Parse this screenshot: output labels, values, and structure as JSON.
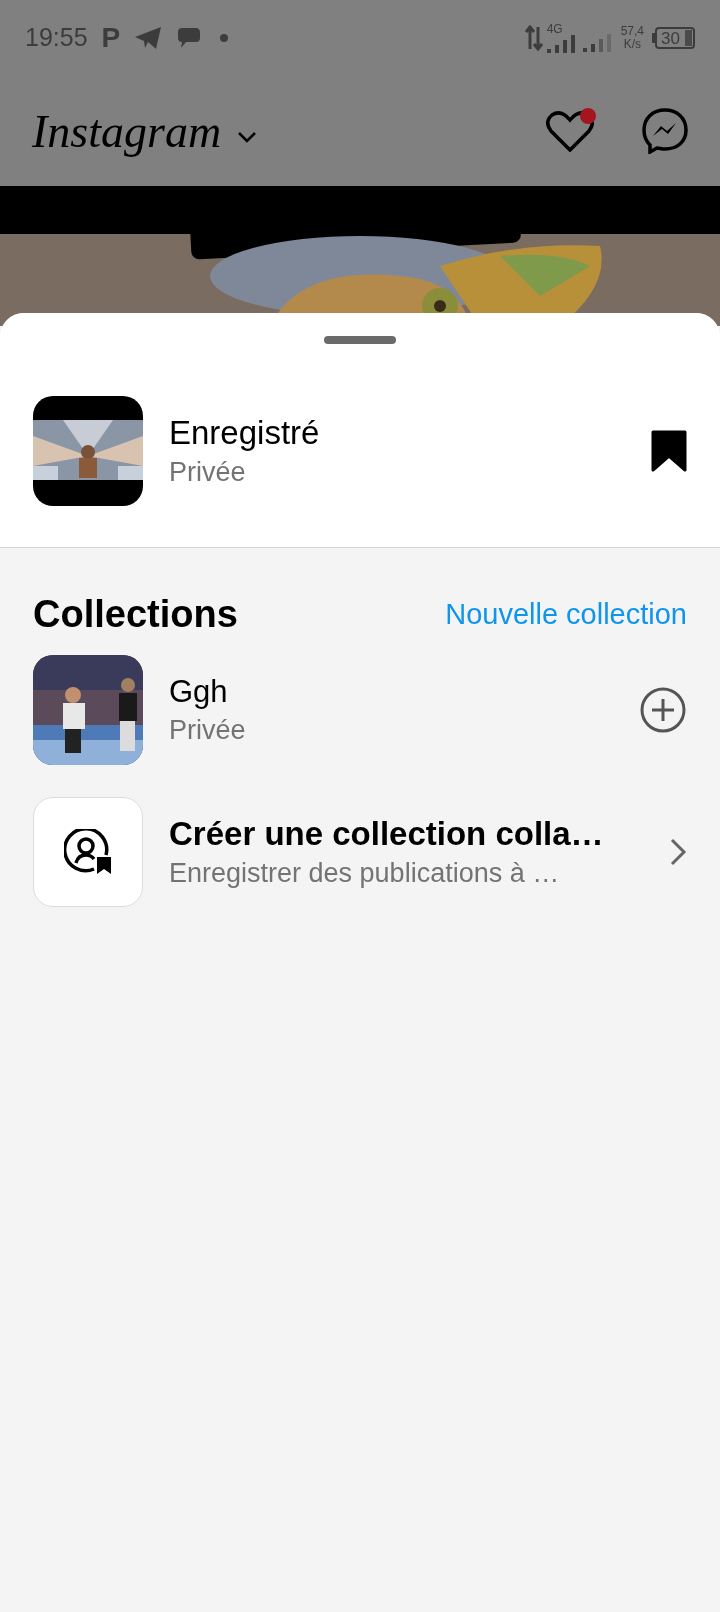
{
  "status_bar": {
    "time": "19:55",
    "app_letter": "P",
    "network": "4G",
    "speed": "57,4",
    "speed_unit": "K/s",
    "battery": "30"
  },
  "header": {
    "logo": "Instagram",
    "has_notification": true
  },
  "saved": {
    "title": "Enregistré",
    "subtitle": "Privée",
    "bookmarked": true
  },
  "collections": {
    "title": "Collections",
    "new_link": "Nouvelle collection",
    "items": [
      {
        "kind": "collection",
        "title": "Ggh",
        "subtitle": "Privée"
      },
      {
        "kind": "create",
        "title": "Créer une collection colla…",
        "subtitle": "Enregistrer des publications à …"
      }
    ]
  }
}
